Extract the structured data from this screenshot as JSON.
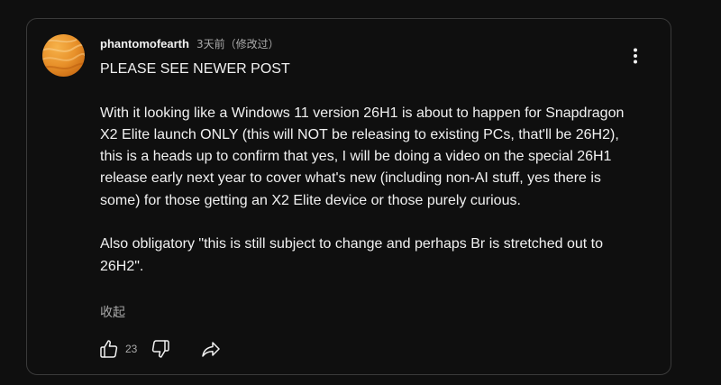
{
  "comment": {
    "author": "phantomofearth",
    "time": "3天前（修改过）",
    "paragraphs": [
      "PLEASE SEE NEWER POST",
      "With it looking like a Windows 11 version 26H1 is about to happen for Snapdragon X2 Elite launch ONLY (this will NOT be releasing to existing PCs, that'll be 26H2), this is a heads up to confirm that yes, I will be doing a video on the special 26H1 release early next year to cover what's new (including non-AI stuff, yes there is some) for those getting an X2 Elite device or those purely curious.",
      "Also obligatory \"this is still subject to change and perhaps Br is stretched out to 26H2\"."
    ],
    "collapse_label": "收起",
    "like_count": "23"
  },
  "icons": {
    "more": "more-vert-icon",
    "like": "thumbs-up-icon",
    "dislike": "thumbs-down-icon",
    "share": "share-icon"
  },
  "colors": {
    "background": "#0f0f0f",
    "text": "#f1f1f1",
    "secondary_text": "#aaaaaa",
    "border": "#3a3a3a",
    "avatar_orange": "#e8912a"
  }
}
